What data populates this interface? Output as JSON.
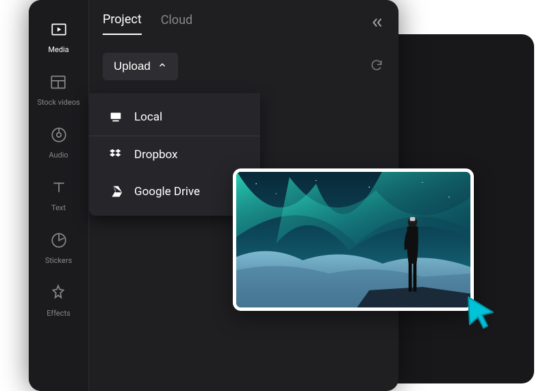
{
  "sidebar": {
    "items": [
      {
        "label": "Media",
        "icon": "media",
        "active": true
      },
      {
        "label": "Stock videos",
        "icon": "stock"
      },
      {
        "label": "Audio",
        "icon": "audio"
      },
      {
        "label": "Text",
        "icon": "text"
      },
      {
        "label": "Stickers",
        "icon": "stickers"
      },
      {
        "label": "Effects",
        "icon": "effects"
      }
    ]
  },
  "tabs": {
    "project": "Project",
    "cloud": "Cloud",
    "active": "project"
  },
  "upload": {
    "label": "Upload",
    "menu": [
      {
        "label": "Local",
        "icon": "local"
      },
      {
        "label": "Dropbox",
        "icon": "dropbox"
      },
      {
        "label": "Google Drive",
        "icon": "gdrive"
      }
    ]
  },
  "thumbnail": {
    "description": "Person standing viewing aurora borealis over snowy mountains"
  },
  "colors": {
    "accent": "#00c4d6"
  }
}
